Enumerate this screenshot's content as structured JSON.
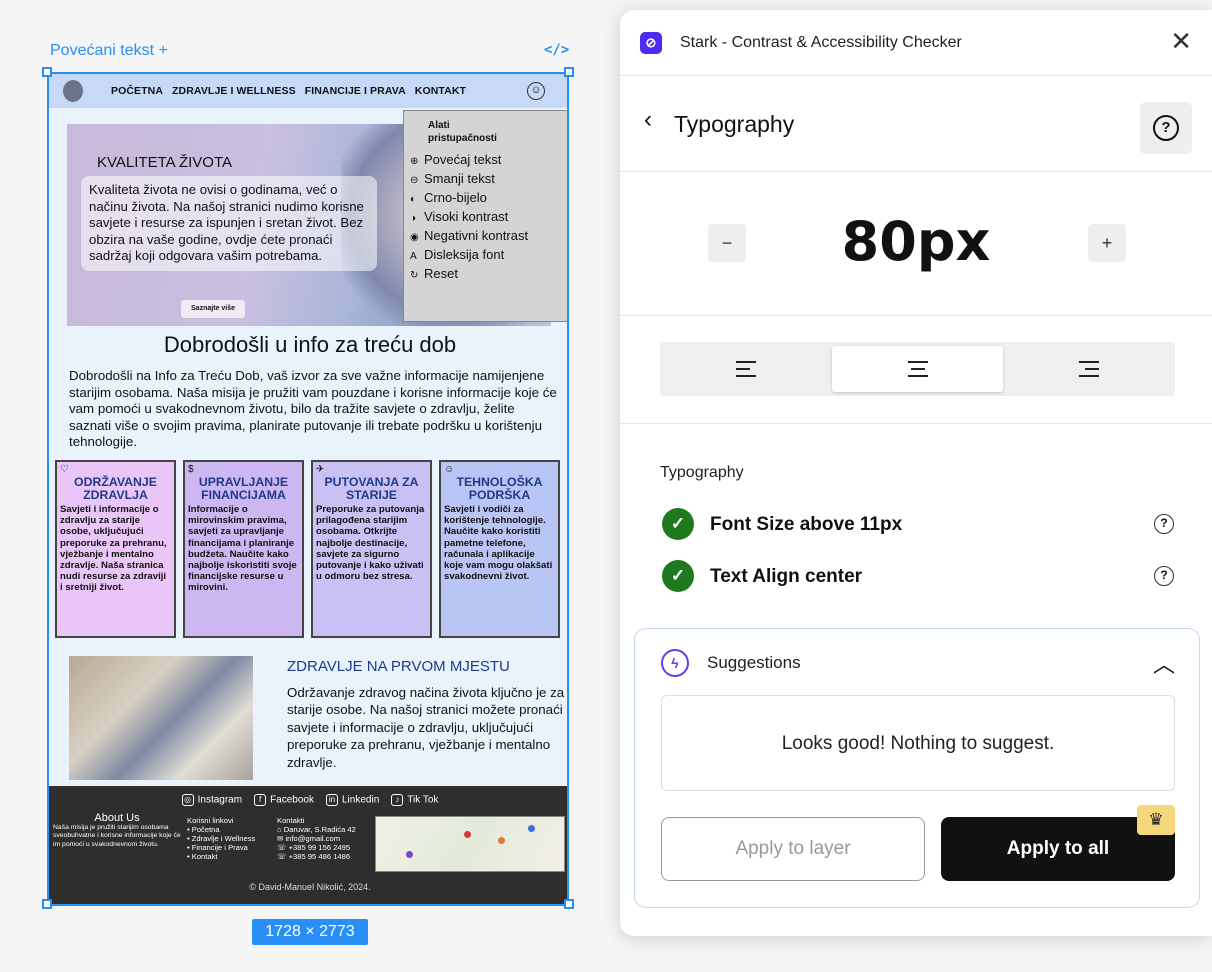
{
  "canvas": {
    "frame_label": "Povećani tekst +",
    "code_icon": "</>",
    "dimensions": "1728 × 2773"
  },
  "site": {
    "nav": [
      "POČETNA",
      "ZDRAVLJE I WELLNESS",
      "FINANCIJE I PRAVA",
      "KONTAKT"
    ],
    "hero": {
      "title": "KVALITETA ŽIVOTA",
      "text": "Kvaliteta života ne ovisi o godinama, već o načinu života. Na našoj stranici nudimo korisne savjete i resurse za ispunjen i sretan život. Bez obzira na vaše godine, ovdje ćete pronaći sadržaj koji odgovara vašim potrebama.",
      "button": "Saznajte više"
    },
    "a11y": {
      "title": "Alati pristupačnosti",
      "items": [
        {
          "icon": "⊕",
          "label": "Povećaj tekst"
        },
        {
          "icon": "⊖",
          "label": "Smanji tekst"
        },
        {
          "icon": "◐",
          "label": "Crno-bijelo"
        },
        {
          "icon": "◑",
          "label": "Visoki kontrast"
        },
        {
          "icon": "◉",
          "label": "Negativni kontrast"
        },
        {
          "icon": "A",
          "label": "Disleksija font"
        },
        {
          "icon": "↻",
          "label": "Reset"
        }
      ]
    },
    "welcome": {
      "title": "Dobrodošli u info za treću dob",
      "text": "Dobrodošli na Info za Treću Dob, vaš izvor za sve važne informacije namijenjene starijim osobama. Naša misija je pružiti vam pouzdane i korisne informacije koje će vam pomoći u svakodnevnom životu, bilo da tražite savjete o zdravlju, želite saznati više o svojim pravima, planirate putovanje ili trebate podršku u korištenju tehnologije."
    },
    "cards": [
      {
        "icon": "♡",
        "title": "ODRŽAVANJE ZDRAVLJA",
        "text": "Savjeti i informacije o zdravlju za starije osobe, uključujući preporuke za prehranu, vježbanje i mentalno zdravlje. Naša stranica nudi resurse za zdraviji i sretniji život."
      },
      {
        "icon": "$",
        "title": "UPRAVLJANJE FINANCIJAMA",
        "text": "Informacije o mirovinskim pravima, savjeti za upravljanje financijama i planiranje budžeta. Naučite kako najbolje iskoristiti svoje financijske resurse u mirovini."
      },
      {
        "icon": "✈",
        "title": "PUTOVANJA ZA STARIJE",
        "text": "Preporuke za putovanja prilagođena starijim osobama. Otkrijte najbolje destinacije, savjete za sigurno putovanje i kako uživati u odmoru bez stresa."
      },
      {
        "icon": "☺",
        "title": "TEHNOLOŠKA PODRŠKA",
        "text": "Savjeti i vodiči za korištenje tehnologije. Naučite kako koristiti pametne telefone, računala i aplikacije koje vam mogu olakšati svakodnevni život."
      }
    ],
    "health": {
      "title": "ZDRAVLJE NA PRVOM MJESTU",
      "text": "Održavanje zdravog načina života ključno je za starije osobe. Na našoj stranici možete pronaći savjete i informacije o zdravlju, uključujući preporuke za prehranu, vježbanje i mentalno zdravlje."
    },
    "footer": {
      "social": [
        "Instagram",
        "Facebook",
        "Linkedin",
        "Tik Tok"
      ],
      "about_title": "About Us",
      "about_text": "Naša misija je pružiti starijim osobama sveobuhvatne i korisne informacije koje će im pomoći u svakodnevnom životu.",
      "links_title": "Korisni linkovi",
      "links": [
        "• Početna",
        "• Zdravlje i Wellness",
        "• Financije i Prava",
        "• Kontakt"
      ],
      "contact_title": "Kontakti",
      "contact": [
        "⌂ Daruvar, S.Radića 42",
        "✉ info@gmail.com",
        "☏ +385 99 156 2495",
        "☏ +385 95 486 1486"
      ],
      "copyright": "©    David-Manuel Nikolić, 2024."
    }
  },
  "panel": {
    "app_title": "Stark - Contrast & Accessibility Checker",
    "section_title": "Typography",
    "font_size": "80px",
    "decrement": "−",
    "increment": "+",
    "active_alignment": "center",
    "checks_title": "Typography",
    "checks": [
      {
        "label": "Font Size above 11px",
        "status": "pass"
      },
      {
        "label": "Text Align center",
        "status": "pass"
      }
    ],
    "suggestions_title": "Suggestions",
    "suggestion_message": "Looks good! Nothing to suggest.",
    "apply_layer": "Apply to layer",
    "apply_all": "Apply to all",
    "colors": {
      "accent": "#4b2df2",
      "pass": "#1f7a1f",
      "selection": "#2a8ef7",
      "premium": "#f7d77b"
    }
  }
}
